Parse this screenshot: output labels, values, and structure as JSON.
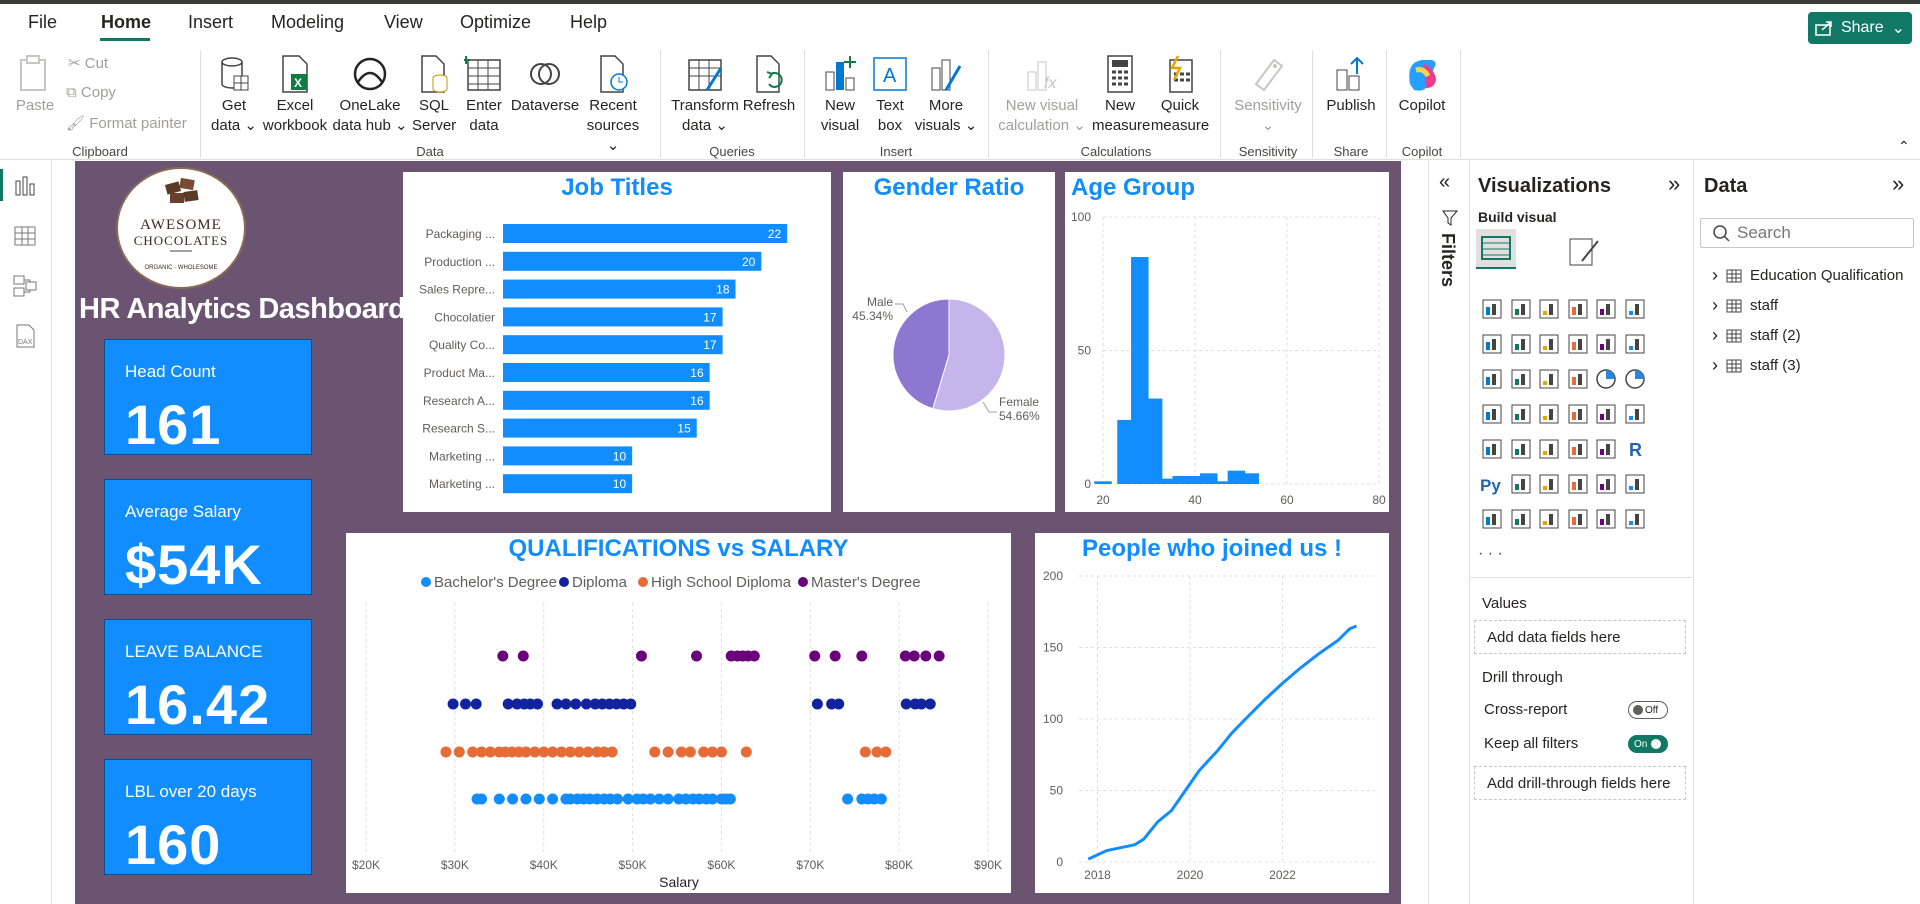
{
  "menu": {
    "file": "File",
    "home": "Home",
    "insert": "Insert",
    "modeling": "Modeling",
    "view": "View",
    "optimize": "Optimize",
    "help": "Help",
    "share": "Share"
  },
  "ribbon": {
    "paste": "Paste",
    "cut": "Cut",
    "copy": "Copy",
    "format_painter": "Format painter",
    "clipboard": "Clipboard",
    "get_data": [
      "Get",
      "data ⌄"
    ],
    "excel": [
      "Excel",
      "workbook"
    ],
    "onelake": [
      "OneLake",
      "data hub ⌄"
    ],
    "sql": [
      "SQL",
      "Server"
    ],
    "enter_data": [
      "Enter",
      "data"
    ],
    "dataverse": [
      "Dataverse",
      ""
    ],
    "recent": [
      "Recent",
      "sources ⌄"
    ],
    "data_group": "Data",
    "transform": [
      "Transform",
      "data ⌄"
    ],
    "refresh": [
      "Refresh",
      ""
    ],
    "queries": "Queries",
    "new_visual": [
      "New",
      "visual"
    ],
    "text_box": [
      "Text",
      "box"
    ],
    "more_visuals": [
      "More",
      "visuals ⌄"
    ],
    "insert_group": "Insert",
    "new_visual_calc": [
      "New visual",
      "calculation ⌄"
    ],
    "new_measure": [
      "New",
      "measure"
    ],
    "quick_measure": [
      "Quick",
      "measure"
    ],
    "calculations": "Calculations",
    "sensitivity_btn": [
      "Sensitivity",
      "⌄"
    ],
    "sensitivity": "Sensitivity",
    "publish": [
      "Publish",
      ""
    ],
    "share_group": "Share",
    "copilot": [
      "Copilot",
      ""
    ],
    "copilot_group": "Copilot"
  },
  "report": {
    "logo_line1": "AWESOME",
    "logo_line2": "CHOCOLATES",
    "logo_line3": "ORGANIC · WHOLESOME",
    "title": "HR Analytics Dashboard",
    "kpis": [
      {
        "label": "Head Count",
        "value": "161"
      },
      {
        "label": "Average Salary",
        "value": "$54K"
      },
      {
        "label": "LEAVE BALANCE",
        "value": "16.42"
      },
      {
        "label": "LBL over 20 days",
        "value": "160"
      }
    ]
  },
  "filters_label": "Filters",
  "visualizations": {
    "title": "Visualizations",
    "build_visual": "Build visual",
    "values": "Values",
    "add_fields": "Add data fields here",
    "drill_through": "Drill through",
    "cross_report": "Cross-report",
    "cross_report_state": "Off",
    "keep_filters": "Keep all filters",
    "keep_filters_state": "On",
    "add_drill": "Add drill-through fields here",
    "more": "· · ·"
  },
  "data_pane": {
    "title": "Data",
    "search_placeholder": "Search",
    "tables": [
      "Education Qualification",
      "staff",
      "staff (2)",
      "staff (3)"
    ]
  },
  "colors": {
    "accent": "#117865",
    "blue": "#118dff",
    "report_bg": "#6b5372",
    "bachelor": "#118dff",
    "diploma": "#12239e",
    "high_school": "#e66c37",
    "masters": "#6b007b",
    "male": "#8e77d0",
    "female": "#c5b5ea"
  },
  "chart_data": [
    {
      "id": "job_titles",
      "type": "bar",
      "orientation": "horizontal",
      "title": "Job Titles",
      "categories": [
        "Packaging ...",
        "Production ...",
        "Sales Repre...",
        "Chocolatier",
        "Quality Co...",
        "Product Ma...",
        "Research A...",
        "Research S...",
        "Marketing ...",
        "Marketing ..."
      ],
      "values": [
        22,
        20,
        18,
        17,
        17,
        16,
        16,
        15,
        10,
        10
      ],
      "xlim": [
        0,
        24
      ]
    },
    {
      "id": "gender_ratio",
      "type": "pie",
      "title": "Gender Ratio",
      "slices": [
        {
          "label": "Male",
          "value": 45.34,
          "text": "45.34%"
        },
        {
          "label": "Female",
          "value": 54.66,
          "text": "54.66%"
        }
      ]
    },
    {
      "id": "age_group",
      "type": "bar",
      "title": "Age Group",
      "x": [
        20,
        25,
        28,
        31,
        34,
        37,
        40,
        43,
        46,
        49,
        52,
        55,
        58,
        61,
        64,
        67
      ],
      "values": [
        1,
        24,
        85,
        32,
        2,
        3,
        3,
        4,
        1,
        5,
        4,
        0,
        0,
        0,
        0,
        0
      ],
      "xticks": [
        "20",
        "40",
        "60",
        "80"
      ],
      "yticks": [
        "0",
        "50",
        "100"
      ],
      "xlim": [
        20,
        80
      ],
      "ylim": [
        0,
        100
      ],
      "grid": true
    },
    {
      "id": "qual_salary",
      "type": "scatter",
      "title": "QUALIFICATIONS vs SALARY",
      "xlabel": "Salary",
      "xticks": [
        "$20K",
        "$30K",
        "$40K",
        "$50K",
        "$60K",
        "$70K",
        "$80K",
        "$90K"
      ],
      "xlim": [
        20000,
        90000
      ],
      "legend": "top",
      "series": [
        {
          "name": "Bachelor's Degree",
          "key": "bachelor",
          "x": [
            32500,
            33000,
            35000,
            36500,
            38000,
            39500,
            41000,
            42500,
            43000,
            43800,
            44500,
            45200,
            46000,
            46800,
            47500,
            48300,
            49500,
            50500,
            51200,
            52000,
            53000,
            54000,
            55200,
            56000,
            56800,
            57500,
            58300,
            59000,
            60000,
            60500,
            61000,
            74200,
            75800,
            76500,
            77200,
            78000
          ]
        },
        {
          "name": "Diploma",
          "key": "diploma",
          "x": [
            29800,
            31200,
            32400,
            36000,
            37000,
            37800,
            38500,
            39300,
            41500,
            42500,
            43600,
            44800,
            45800,
            46600,
            47400,
            48200,
            49000,
            49800,
            70800,
            72400,
            73200,
            80800,
            81800,
            82500,
            83500
          ]
        },
        {
          "name": "High School Diploma",
          "key": "high_school",
          "x": [
            29000,
            30500,
            32000,
            33000,
            34000,
            35000,
            35700,
            36400,
            37200,
            38000,
            39000,
            40000,
            41000,
            42000,
            43000,
            44000,
            45000,
            46000,
            46800,
            47700,
            52500,
            54000,
            55500,
            56500,
            58000,
            59000,
            60000,
            62800,
            76200,
            77500,
            78500
          ]
        },
        {
          "name": "Master's Degree",
          "key": "masters",
          "x": [
            35400,
            37700,
            51000,
            57200,
            61100,
            61800,
            62400,
            63000,
            63700,
            70500,
            72800,
            75800,
            80700,
            81700,
            83000,
            84500
          ]
        }
      ]
    },
    {
      "id": "joined",
      "type": "line",
      "title": "People who joined us !",
      "x": [
        2017.8,
        2018.2,
        2018.8,
        2019.0,
        2019.3,
        2019.6,
        2019.9,
        2020.2,
        2020.6,
        2020.9,
        2021.2,
        2021.6,
        2022.0,
        2022.4,
        2022.8,
        2023.2,
        2023.45,
        2023.6
      ],
      "values": [
        2,
        8,
        12,
        16,
        28,
        36,
        50,
        64,
        78,
        90,
        100,
        113,
        125,
        136,
        146,
        155,
        163,
        165
      ],
      "xticks": [
        "2018",
        "2020",
        "2022"
      ],
      "yticks": [
        "0",
        "50",
        "100",
        "150",
        "200"
      ],
      "ylim": [
        0,
        200
      ],
      "xlim": [
        2017.6,
        2024
      ],
      "grid": true
    }
  ]
}
